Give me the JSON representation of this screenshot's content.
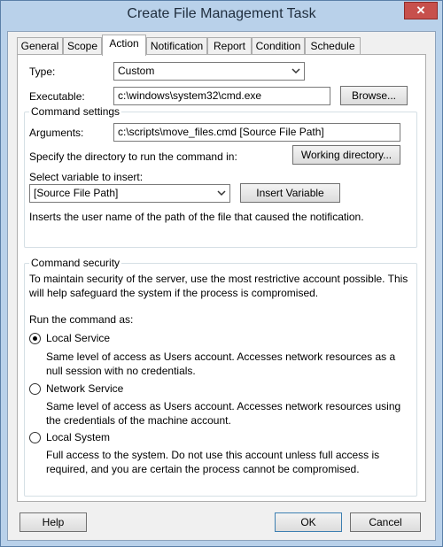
{
  "window": {
    "title": "Create File Management Task",
    "close_glyph": "✕"
  },
  "tabs": [
    {
      "label": "General",
      "active": false
    },
    {
      "label": "Scope",
      "active": false
    },
    {
      "label": "Action",
      "active": true
    },
    {
      "label": "Notification",
      "active": false
    },
    {
      "label": "Report",
      "active": false
    },
    {
      "label": "Condition",
      "active": false
    },
    {
      "label": "Schedule",
      "active": false
    }
  ],
  "action": {
    "type_label": "Type:",
    "type_value": "Custom",
    "executable_label": "Executable:",
    "executable_value": "c:\\windows\\system32\\cmd.exe",
    "browse_label": "Browse..."
  },
  "command_settings": {
    "title": "Command settings",
    "arguments_label": "Arguments:",
    "arguments_value": "c:\\scripts\\move_files.cmd [Source File Path]",
    "directory_text": "Specify the directory to run the command in:",
    "working_directory_label": "Working directory...",
    "select_variable_label": "Select variable to insert:",
    "variable_value": "[Source File Path]",
    "insert_variable_label": "Insert Variable",
    "variable_description": "Inserts the user name of the path of the file that caused the notification."
  },
  "command_security": {
    "title": "Command security",
    "intro_line1": "To maintain security of the server, use the most restrictive account possible. This",
    "intro_line2": "will help safeguard the system if the process is compromised.",
    "run_as_label": "Run the command as:",
    "options": [
      {
        "label": "Local Service",
        "selected": true,
        "desc1": "Same level of access as Users account. Accesses network resources as a",
        "desc2": "null session with no credentials."
      },
      {
        "label": "Network Service",
        "selected": false,
        "desc1": "Same level of access as Users account. Accesses network resources using",
        "desc2": "the credentials of the machine account."
      },
      {
        "label": "Local System",
        "selected": false,
        "desc1": "Full access to the system. Do not use this account unless full access is",
        "desc2": "required, and you are certain the process cannot be compromised."
      }
    ]
  },
  "footer": {
    "help_label": "Help",
    "ok_label": "OK",
    "cancel_label": "Cancel"
  }
}
